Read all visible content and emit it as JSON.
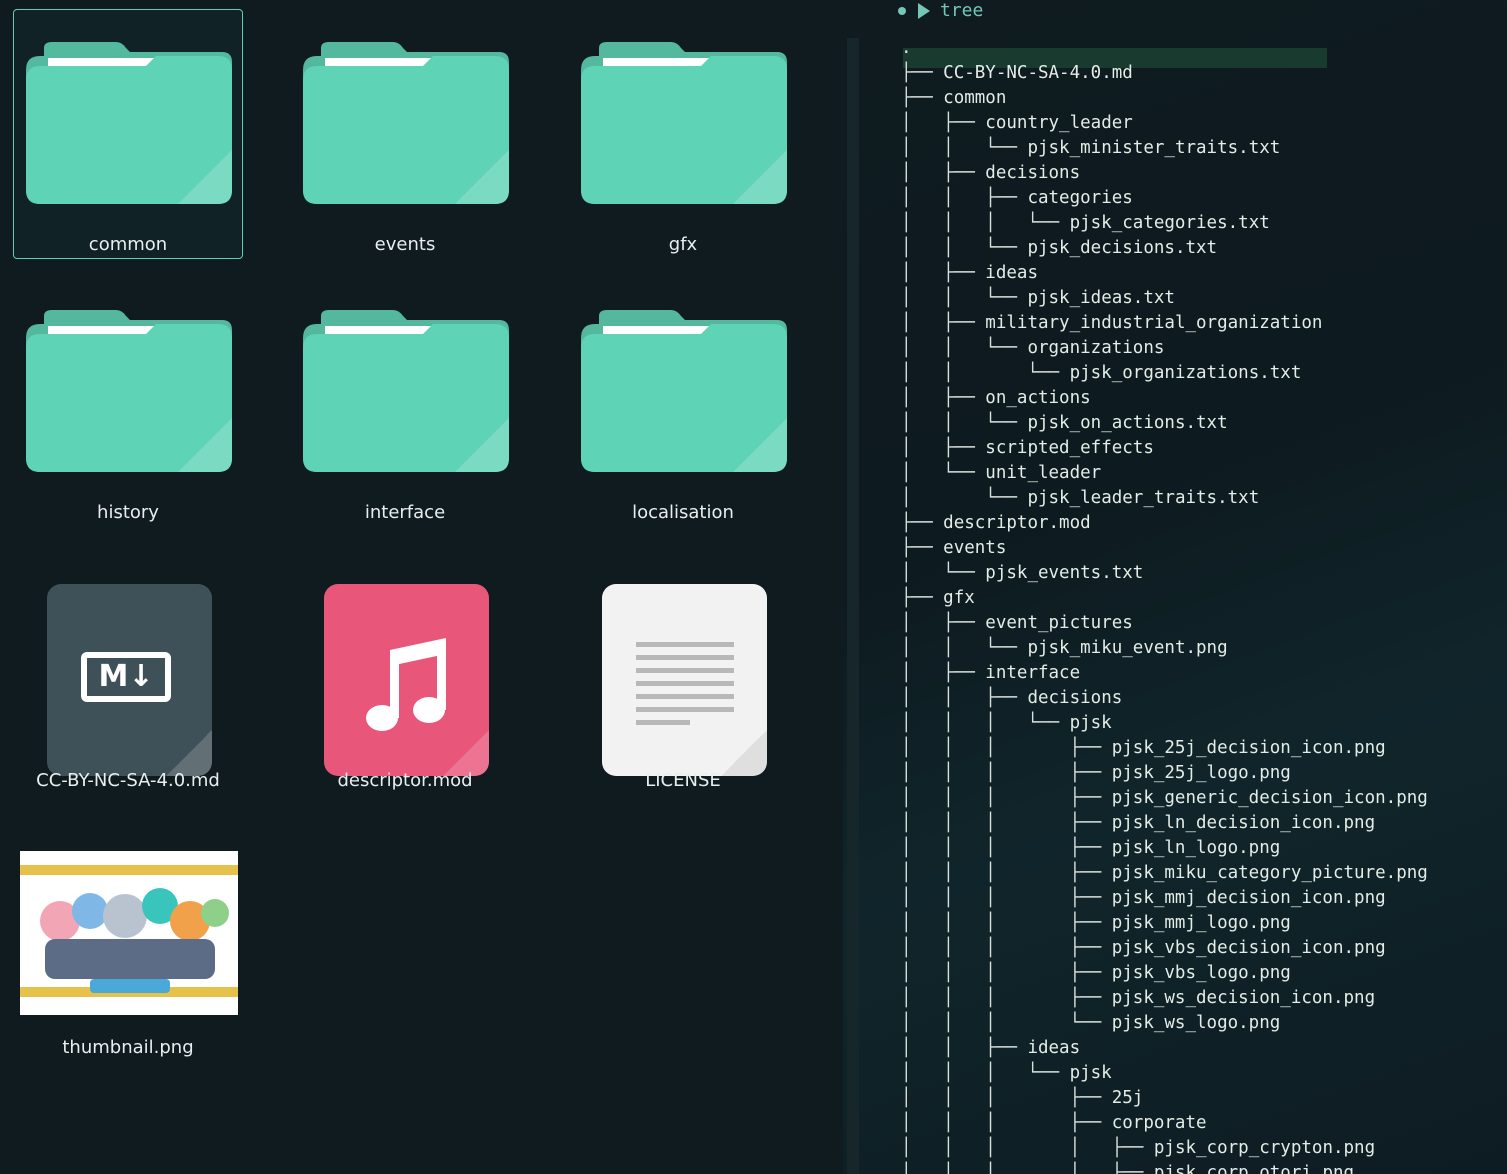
{
  "file_manager": {
    "items": [
      {
        "name": "common",
        "type": "folder",
        "selected": true
      },
      {
        "name": "events",
        "type": "folder",
        "selected": false
      },
      {
        "name": "gfx",
        "type": "folder",
        "selected": false
      },
      {
        "name": "history",
        "type": "folder",
        "selected": false
      },
      {
        "name": "interface",
        "type": "folder",
        "selected": false
      },
      {
        "name": "localisation",
        "type": "folder",
        "selected": false
      },
      {
        "name": "CC-BY-NC-SA-4.0.md",
        "type": "markdown",
        "selected": false
      },
      {
        "name": "descriptor.mod",
        "type": "audio",
        "selected": false
      },
      {
        "name": "LICENSE",
        "type": "text",
        "selected": false
      },
      {
        "name": "thumbnail.png",
        "type": "image",
        "selected": false
      }
    ],
    "folder_color": "#5fd3b5",
    "markdown_badge": "M↓"
  },
  "terminal": {
    "command": "tree",
    "lines": [
      {
        "prefix": ".",
        "name": ""
      },
      {
        "prefix": "├── ",
        "name": "CC-BY-NC-SA-4.0.md"
      },
      {
        "prefix": "├── ",
        "name": "common"
      },
      {
        "prefix": "│   ├── ",
        "name": "country_leader"
      },
      {
        "prefix": "│   │   └── ",
        "name": "pjsk_minister_traits.txt"
      },
      {
        "prefix": "│   ├── ",
        "name": "decisions"
      },
      {
        "prefix": "│   │   ├── ",
        "name": "categories"
      },
      {
        "prefix": "│   │   │   └── ",
        "name": "pjsk_categories.txt"
      },
      {
        "prefix": "│   │   └── ",
        "name": "pjsk_decisions.txt"
      },
      {
        "prefix": "│   ├── ",
        "name": "ideas"
      },
      {
        "prefix": "│   │   └── ",
        "name": "pjsk_ideas.txt"
      },
      {
        "prefix": "│   ├── ",
        "name": "military_industrial_organization"
      },
      {
        "prefix": "│   │   └── ",
        "name": "organizations"
      },
      {
        "prefix": "│   │       └── ",
        "name": "pjsk_organizations.txt"
      },
      {
        "prefix": "│   ├── ",
        "name": "on_actions"
      },
      {
        "prefix": "│   │   └── ",
        "name": "pjsk_on_actions.txt"
      },
      {
        "prefix": "│   ├── ",
        "name": "scripted_effects"
      },
      {
        "prefix": "│   └── ",
        "name": "unit_leader"
      },
      {
        "prefix": "│       └── ",
        "name": "pjsk_leader_traits.txt"
      },
      {
        "prefix": "├── ",
        "name": "descriptor.mod"
      },
      {
        "prefix": "├── ",
        "name": "events"
      },
      {
        "prefix": "│   └── ",
        "name": "pjsk_events.txt"
      },
      {
        "prefix": "├── ",
        "name": "gfx"
      },
      {
        "prefix": "│   ├── ",
        "name": "event_pictures"
      },
      {
        "prefix": "│   │   └── ",
        "name": "pjsk_miku_event.png"
      },
      {
        "prefix": "│   ├── ",
        "name": "interface"
      },
      {
        "prefix": "│   │   ├── ",
        "name": "decisions"
      },
      {
        "prefix": "│   │   │   └── ",
        "name": "pjsk"
      },
      {
        "prefix": "│   │   │       ├── ",
        "name": "pjsk_25j_decision_icon.png"
      },
      {
        "prefix": "│   │   │       ├── ",
        "name": "pjsk_25j_logo.png"
      },
      {
        "prefix": "│   │   │       ├── ",
        "name": "pjsk_generic_decision_icon.png"
      },
      {
        "prefix": "│   │   │       ├── ",
        "name": "pjsk_ln_decision_icon.png"
      },
      {
        "prefix": "│   │   │       ├── ",
        "name": "pjsk_ln_logo.png"
      },
      {
        "prefix": "│   │   │       ├── ",
        "name": "pjsk_miku_category_picture.png"
      },
      {
        "prefix": "│   │   │       ├── ",
        "name": "pjsk_mmj_decision_icon.png"
      },
      {
        "prefix": "│   │   │       ├── ",
        "name": "pjsk_mmj_logo.png"
      },
      {
        "prefix": "│   │   │       ├── ",
        "name": "pjsk_vbs_decision_icon.png"
      },
      {
        "prefix": "│   │   │       ├── ",
        "name": "pjsk_vbs_logo.png"
      },
      {
        "prefix": "│   │   │       ├── ",
        "name": "pjsk_ws_decision_icon.png"
      },
      {
        "prefix": "│   │   │       └── ",
        "name": "pjsk_ws_logo.png"
      },
      {
        "prefix": "│   │   ├── ",
        "name": "ideas"
      },
      {
        "prefix": "│   │   │   └── ",
        "name": "pjsk"
      },
      {
        "prefix": "│   │   │       ├── ",
        "name": "25j"
      },
      {
        "prefix": "│   │   │       ├── ",
        "name": "corporate"
      },
      {
        "prefix": "│   │   │       │   ├── ",
        "name": "pjsk_corp_crypton.png"
      },
      {
        "prefix": "│   │   │       │   ├── ",
        "name": "pjsk_corp_otori.png"
      }
    ]
  }
}
